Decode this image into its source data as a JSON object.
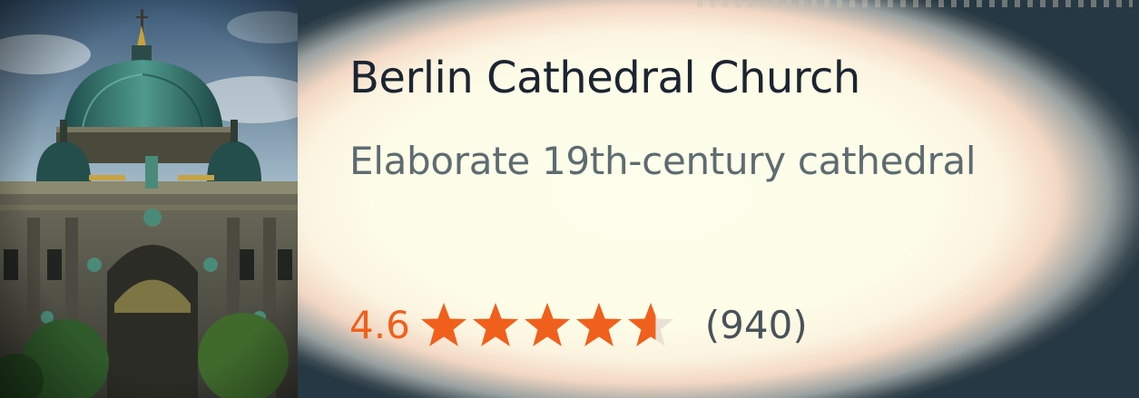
{
  "place": {
    "name": "Berlin Cathedral Church",
    "description": "Elaborate 19th-century cathedral",
    "rating": "4.6",
    "rating_value": 4.6,
    "rating_max": 5,
    "review_count": "(940)",
    "photo_icon": "cathedral-photo"
  },
  "colors": {
    "accent": "#f0601c",
    "title": "#1c2431",
    "subtitle": "#5e6b70",
    "star_empty": "#e8e2d6"
  }
}
